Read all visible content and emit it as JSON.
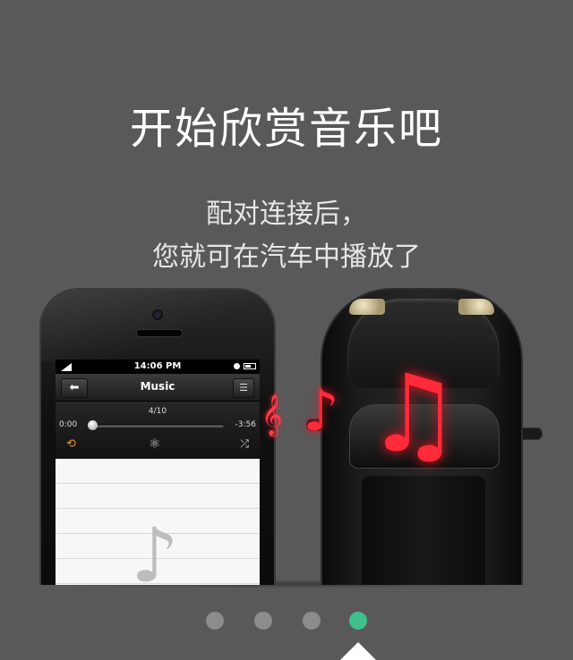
{
  "headline": "开始欣赏音乐吧",
  "description": {
    "line1": "配对连接后，",
    "line2": "您就可在汽车中播放了"
  },
  "phone_screen": {
    "status_time": "14:06 PM",
    "nav_title": "Music",
    "back_icon": "back-arrow-icon",
    "list_icon": "list-icon",
    "track_count": "4/10",
    "elapsed": "0:00",
    "remaining": "-3:56",
    "progress": 0,
    "repeat_icon": "repeat-icon",
    "genius_icon": "genius-icon",
    "shuffle_icon": "shuffle-icon",
    "artwork_icon": "music-note-icon"
  },
  "illustration": {
    "note_color": "#ff2a3a",
    "car_color": "#1d1d1d"
  },
  "pager": {
    "total": 4,
    "current": 4,
    "active_color": "#3fbf8c",
    "inactive_color": "#8c8c8c"
  }
}
